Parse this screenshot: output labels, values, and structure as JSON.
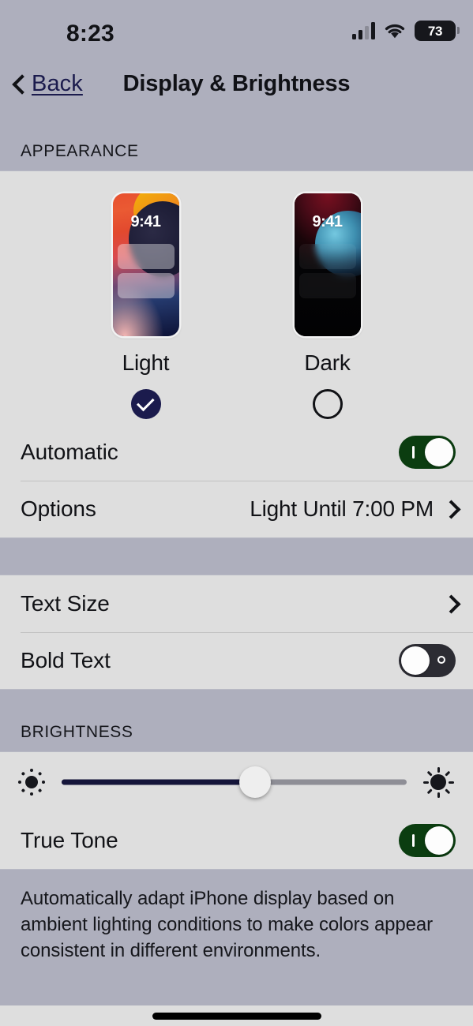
{
  "status_bar": {
    "time": "8:23",
    "signal_icon": "cellular-signal-icon",
    "wifi_icon": "wifi-icon",
    "battery_level": "73"
  },
  "nav": {
    "back_label": "Back",
    "back_icon": "chevron-left-icon",
    "title": "Display & Brightness"
  },
  "appearance": {
    "section_header": "APPEARANCE",
    "options": [
      {
        "name": "Light",
        "preview_time": "9:41",
        "selected": true
      },
      {
        "name": "Dark",
        "preview_time": "9:41",
        "selected": false
      }
    ],
    "automatic": {
      "label": "Automatic",
      "state": "on"
    },
    "options_row": {
      "label": "Options",
      "value": "Light Until 7:00 PM",
      "chevron": "chevron-right-icon"
    }
  },
  "text_group": {
    "text_size": {
      "label": "Text Size",
      "chevron": "chevron-right-icon"
    },
    "bold_text": {
      "label": "Bold Text",
      "state": "off"
    }
  },
  "brightness": {
    "section_header": "BRIGHTNESS",
    "low_icon": "sun-min-icon",
    "high_icon": "sun-max-icon",
    "value_percent": 56,
    "true_tone": {
      "label": "True Tone",
      "state": "on"
    },
    "footer_note": "Automatically adapt iPhone display based on ambient lighting conditions to make colors appear consistent in different environments."
  },
  "colors": {
    "page_background": "#aeafbd",
    "card_background": "#dedede",
    "toggle_on": "#0b3d10",
    "toggle_off": "#2c2c33",
    "accent_selected": "#1b1b4d",
    "link": "#1b1b4d"
  },
  "home_indicator": "home-indicator-bar"
}
